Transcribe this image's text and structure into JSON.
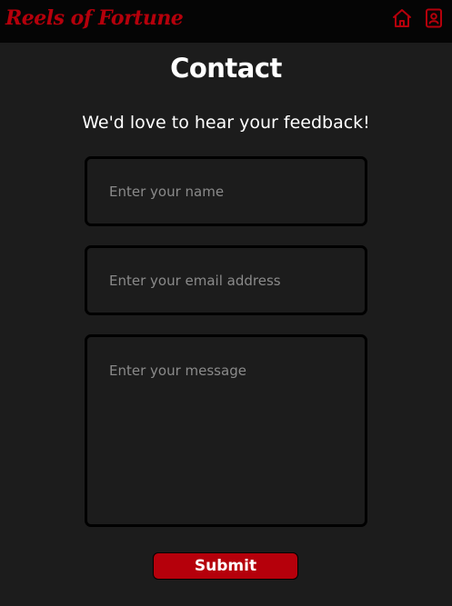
{
  "header": {
    "brand": "Reels of Fortune",
    "nav_icons": [
      "home-icon",
      "contact-book-icon"
    ],
    "accent_color": "#b5000b",
    "background_color": "#050505"
  },
  "main": {
    "title": "Contact",
    "subtitle": "We'd love to hear your feedback!",
    "background_color": "#1c1c1c"
  },
  "form": {
    "name_placeholder": "Enter your name",
    "name_value": "",
    "email_placeholder": "Enter your email address",
    "email_value": "",
    "message_placeholder": "Enter your message",
    "message_value": "",
    "submit_label": "Submit"
  }
}
